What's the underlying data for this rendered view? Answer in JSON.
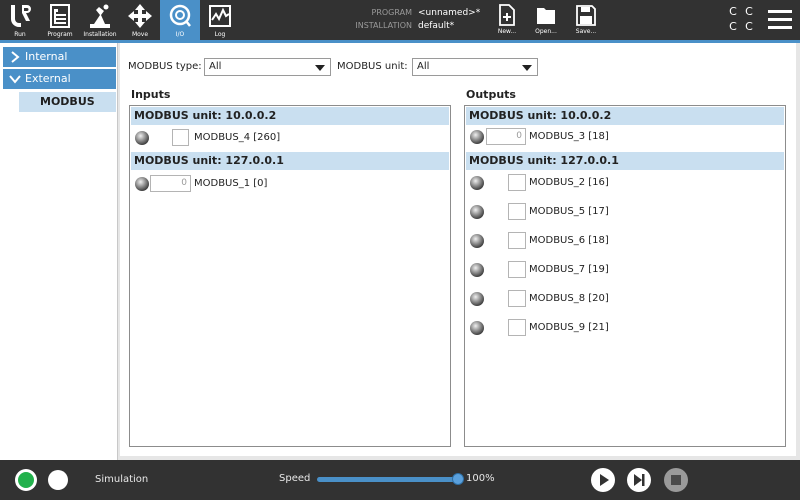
{
  "toolbar": {
    "tabs": [
      {
        "label": "Run",
        "icon": "ur-logo-icon"
      },
      {
        "label": "Program",
        "icon": "program-icon"
      },
      {
        "label": "Installation",
        "icon": "installation-icon"
      },
      {
        "label": "Move",
        "icon": "move-icon"
      },
      {
        "label": "I/O",
        "icon": "io-icon",
        "active": true
      },
      {
        "label": "Log",
        "icon": "log-icon"
      }
    ],
    "program_key": "PROGRAM",
    "program_value": "<unnamed>*",
    "installation_key": "INSTALLATION",
    "installation_value": "default*",
    "file_buttons": [
      {
        "label": "New...",
        "icon": "new-file-icon"
      },
      {
        "label": "Open...",
        "icon": "open-folder-icon"
      },
      {
        "label": "Save...",
        "icon": "save-icon"
      }
    ],
    "cc_glyph": "C"
  },
  "sidebar": {
    "items": [
      {
        "label": "Internal",
        "expanded": false
      },
      {
        "label": "External",
        "expanded": true
      }
    ],
    "sub_items": [
      {
        "label": "MODBUS",
        "selected": true
      }
    ]
  },
  "filters": {
    "type_label": "MODBUS type:",
    "type_value": "All",
    "unit_label": "MODBUS unit:",
    "unit_value": "All"
  },
  "inputs": {
    "title": "Inputs",
    "unit1_header": "MODBUS unit: 10.0.0.2",
    "unit1_rows": [
      {
        "name": "MODBUS_4 [260]",
        "kind": "checkbox"
      }
    ],
    "unit2_header": "MODBUS unit: 127.0.0.1",
    "unit2_rows": [
      {
        "name": "MODBUS_1 [0]",
        "kind": "register",
        "value": "0"
      }
    ]
  },
  "outputs": {
    "title": "Outputs",
    "unit1_header": "MODBUS unit: 10.0.0.2",
    "unit1_rows": [
      {
        "name": "MODBUS_3 [18]",
        "kind": "register",
        "value": "0"
      }
    ],
    "unit2_header": "MODBUS unit: 127.0.0.1",
    "unit2_rows": [
      {
        "name": "MODBUS_2 [16]",
        "kind": "checkbox"
      },
      {
        "name": "MODBUS_5 [17]",
        "kind": "checkbox"
      },
      {
        "name": "MODBUS_6 [18]",
        "kind": "checkbox"
      },
      {
        "name": "MODBUS_7 [19]",
        "kind": "checkbox"
      },
      {
        "name": "MODBUS_8 [20]",
        "kind": "checkbox"
      },
      {
        "name": "MODBUS_9 [21]",
        "kind": "checkbox"
      }
    ]
  },
  "bottom": {
    "power_color": "#22b14c",
    "mode": "Simulation",
    "speed_label": "Speed",
    "speed_value": "100%",
    "speed_fraction": 1.0
  },
  "colors": {
    "accent": "#4a90c8",
    "header_bg": "#323232",
    "unit_header": "#c9dff0"
  }
}
